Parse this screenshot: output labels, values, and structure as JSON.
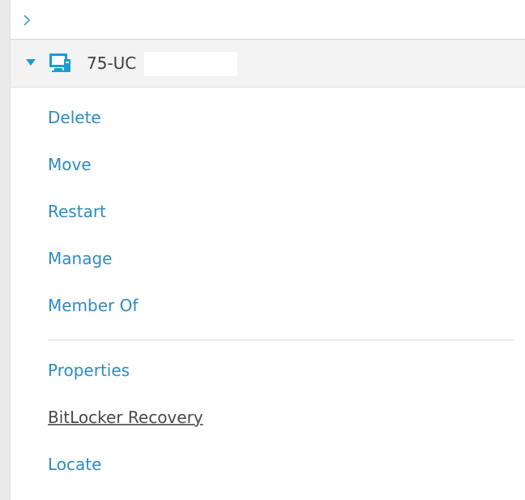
{
  "panel": {
    "collapse_icon": "chevron-right-icon",
    "node": {
      "expand_icon": "caret-down-icon",
      "type_icon": "computer-icon",
      "title": "75-UC"
    },
    "actions_primary": [
      {
        "label": "Delete"
      },
      {
        "label": "Move"
      },
      {
        "label": "Restart"
      },
      {
        "label": "Manage"
      },
      {
        "label": "Member Of"
      }
    ],
    "actions_secondary": [
      {
        "label": "Properties"
      },
      {
        "label": "BitLocker Recovery"
      },
      {
        "label": "Locate"
      }
    ]
  },
  "colors": {
    "link": "#2c8bc1",
    "accent_icon": "#1e9ad6",
    "header_bg": "#f3f3f3",
    "rail_bg": "#e9e9e9"
  }
}
